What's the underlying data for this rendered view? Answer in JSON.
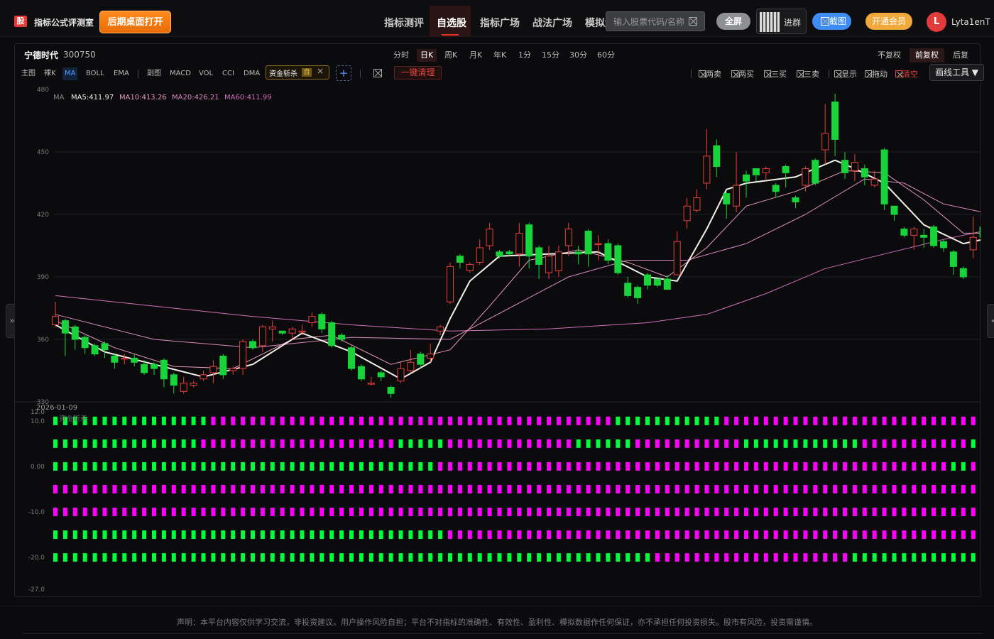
{
  "header": {
    "logo_char": "股",
    "brand": "指标公式评测室",
    "open_desktop": "后期桌面打开",
    "nav": [
      "指标测评",
      "自选股",
      "指标广场",
      "战法广场",
      "模拟盘"
    ],
    "active_nav": 1,
    "search_placeholder": "输入股票代码/名称",
    "fullscreen": "全屏",
    "join_group": "进群",
    "screenshot": "截图",
    "vip": "开通会员",
    "avatar_letter": "L",
    "username": "Lyta1enT"
  },
  "stock": {
    "name": "宁德时代",
    "code": "300750"
  },
  "periods": [
    "分时",
    "日K",
    "周K",
    "月K",
    "年K",
    "1分",
    "15分",
    "30分",
    "60分"
  ],
  "active_period": 1,
  "adjust": [
    "不复权",
    "前复权",
    "后复权"
  ],
  "active_adjust": 1,
  "indicator_row": {
    "main_label": "主图",
    "bare_k": "裸K",
    "main_inds": [
      "MA",
      "BOLL",
      "EMA"
    ],
    "active_main": 0,
    "sub_label": "副图",
    "sub_inds": [
      "MACD",
      "VOL",
      "CCI",
      "DMA"
    ],
    "custom_tag": "资金斩杀",
    "custom_badge": "自",
    "add": "+",
    "clear_all": "一键清理"
  },
  "tools": [
    "两卖",
    "两买",
    "三买",
    "三卖",
    "显示",
    "拖动",
    "清空"
  ],
  "draw_tools": "画线工具",
  "ma_legend": {
    "label": "MA",
    "ma5": "MA5:411.97",
    "ma10": "MA10:413.26",
    "ma20": "MA20:426.21",
    "ma60": "MA60:411.99"
  },
  "colors": {
    "up": "#e8413b",
    "down": "#18d43a",
    "ma5": "#f4efe6",
    "ma10": "#e99bb9",
    "ma20": "#d98ac0",
    "ma60": "#d06fb8",
    "sub_green": "#00ff3c",
    "sub_magenta": "#ff00ff"
  },
  "date_label": "2026-01-09",
  "sub_title": "资金斩杀",
  "chart_data": {
    "type": "candlestick",
    "y_ticks": [
      "480",
      "450",
      "420",
      "390",
      "360",
      "330"
    ],
    "ylim": [
      330,
      480
    ],
    "sub_ticks": [
      "12.0",
      "10.0",
      "0.00",
      "-10.0",
      "-20.0",
      "-27.0"
    ],
    "sub_ylim": [
      -27,
      12
    ],
    "candles": [
      [
        367,
        371,
        378,
        366
      ],
      [
        369,
        363,
        370,
        352
      ],
      [
        366,
        360,
        367,
        355
      ],
      [
        361,
        356,
        362,
        353
      ],
      [
        357,
        353,
        358,
        352
      ],
      [
        358,
        355,
        359,
        351
      ],
      [
        352,
        349,
        353,
        346
      ],
      [
        351,
        351,
        353,
        348
      ],
      [
        351,
        349,
        353,
        347
      ],
      [
        348,
        344,
        350,
        343
      ],
      [
        348,
        346,
        349,
        343
      ],
      [
        350,
        341,
        351,
        337
      ],
      [
        343,
        338,
        344,
        334
      ],
      [
        335,
        339,
        342,
        334
      ],
      [
        338,
        339,
        340,
        337
      ],
      [
        341,
        343,
        345,
        340
      ],
      [
        344,
        347,
        350,
        339
      ],
      [
        352,
        343,
        353,
        341
      ],
      [
        345,
        346,
        347,
        343
      ],
      [
        346,
        359,
        360,
        343
      ],
      [
        359,
        356,
        360,
        355
      ],
      [
        357,
        366,
        367,
        354
      ],
      [
        365,
        366,
        369,
        359
      ],
      [
        364,
        363,
        364,
        362
      ],
      [
        363,
        365,
        366,
        360
      ],
      [
        364,
        364,
        367,
        362
      ],
      [
        368,
        371,
        373,
        366
      ],
      [
        372,
        365,
        373,
        363
      ],
      [
        368,
        357,
        369,
        356
      ],
      [
        362,
        360,
        363,
        359
      ],
      [
        356,
        346,
        357,
        345
      ],
      [
        347,
        341,
        348,
        340
      ],
      [
        339,
        339,
        342,
        338
      ],
      [
        344,
        342,
        345,
        340
      ],
      [
        337,
        334,
        338,
        332
      ],
      [
        340,
        346,
        349,
        339
      ],
      [
        345,
        349,
        355,
        344
      ],
      [
        353,
        348,
        354,
        346
      ],
      [
        351,
        353,
        358,
        349
      ],
      [
        364,
        366,
        367,
        362
      ],
      [
        378,
        395,
        397,
        377
      ],
      [
        400,
        397,
        401,
        394
      ],
      [
        393,
        396,
        397,
        392
      ],
      [
        397,
        404,
        408,
        396
      ],
      [
        405,
        413,
        416,
        403
      ],
      [
        402,
        400,
        403,
        399
      ],
      [
        402,
        401,
        403,
        400
      ],
      [
        401,
        411,
        416,
        395
      ],
      [
        415,
        400,
        416,
        394
      ],
      [
        404,
        396,
        405,
        389
      ],
      [
        392,
        400,
        405,
        389
      ],
      [
        393,
        402,
        405,
        390
      ],
      [
        405,
        413,
        416,
        400
      ],
      [
        402,
        401,
        405,
        396
      ],
      [
        412,
        401,
        413,
        395
      ],
      [
        406,
        406,
        410,
        398
      ],
      [
        406,
        398,
        408,
        396
      ],
      [
        405,
        392,
        406,
        391
      ],
      [
        387,
        381,
        390,
        380
      ],
      [
        385,
        380,
        386,
        377
      ],
      [
        391,
        386,
        392,
        384
      ],
      [
        389,
        386,
        389,
        385
      ],
      [
        389,
        384,
        391,
        384
      ],
      [
        391,
        407,
        412,
        391
      ],
      [
        417,
        424,
        428,
        413
      ],
      [
        422,
        428,
        432,
        421
      ],
      [
        435,
        448,
        461,
        432
      ],
      [
        453,
        443,
        456,
        438
      ],
      [
        430,
        425,
        431,
        418
      ],
      [
        424,
        434,
        450,
        421
      ],
      [
        439,
        436,
        441,
        428
      ],
      [
        442,
        439,
        442,
        436
      ],
      [
        440,
        442,
        443,
        437
      ],
      [
        434,
        431,
        435,
        428
      ],
      [
        443,
        440,
        444,
        433
      ],
      [
        428,
        426,
        429,
        423
      ],
      [
        434,
        442,
        443,
        431
      ],
      [
        446,
        435,
        447,
        434
      ],
      [
        451,
        459,
        473,
        444
      ],
      [
        474,
        456,
        478,
        448
      ],
      [
        446,
        440,
        450,
        437
      ],
      [
        441,
        445,
        449,
        436
      ],
      [
        442,
        438,
        444,
        434
      ],
      [
        434,
        437,
        441,
        433
      ],
      [
        451,
        425,
        452,
        422
      ],
      [
        424,
        420,
        424,
        417
      ],
      [
        413,
        410,
        414,
        409
      ],
      [
        410,
        413,
        414,
        403
      ],
      [
        410,
        409,
        413,
        404
      ],
      [
        414,
        405,
        415,
        404
      ],
      [
        407,
        404,
        408,
        402
      ],
      [
        402,
        395,
        403,
        391
      ],
      [
        394,
        390,
        395,
        389
      ],
      [
        403,
        409,
        419,
        399
      ],
      [
        414,
        409,
        424,
        406
      ],
      [
        414,
        418,
        424,
        413
      ]
    ],
    "ma": {
      "ma5": [
        [
          0,
          367
        ],
        [
          5,
          354
        ],
        [
          10,
          348
        ],
        [
          15,
          342
        ],
        [
          20,
          348
        ],
        [
          25,
          363
        ],
        [
          30,
          354
        ],
        [
          35,
          341
        ],
        [
          38,
          349
        ],
        [
          40,
          370
        ],
        [
          42,
          388
        ],
        [
          45,
          400
        ],
        [
          50,
          401
        ],
        [
          55,
          402
        ],
        [
          60,
          390
        ],
        [
          63,
          388
        ],
        [
          66,
          413
        ],
        [
          68,
          432
        ],
        [
          70,
          435
        ],
        [
          75,
          438
        ],
        [
          79,
          446
        ],
        [
          81,
          442
        ],
        [
          84,
          435
        ],
        [
          88,
          415
        ],
        [
          92,
          406
        ],
        [
          95,
          409
        ]
      ],
      "ma10": [
        [
          0,
          369
        ],
        [
          6,
          356
        ],
        [
          12,
          347
        ],
        [
          18,
          346
        ],
        [
          24,
          360
        ],
        [
          28,
          362
        ],
        [
          34,
          348
        ],
        [
          40,
          355
        ],
        [
          44,
          376
        ],
        [
          48,
          398
        ],
        [
          53,
          403
        ],
        [
          58,
          397
        ],
        [
          62,
          390
        ],
        [
          66,
          404
        ],
        [
          70,
          424
        ],
        [
          75,
          431
        ],
        [
          80,
          441
        ],
        [
          84,
          440
        ],
        [
          88,
          427
        ],
        [
          92,
          411
        ],
        [
          95,
          411
        ]
      ],
      "ma20": [
        [
          0,
          372
        ],
        [
          10,
          360
        ],
        [
          20,
          356
        ],
        [
          30,
          361
        ],
        [
          40,
          360
        ],
        [
          46,
          375
        ],
        [
          52,
          390
        ],
        [
          58,
          398
        ],
        [
          64,
          398
        ],
        [
          70,
          406
        ],
        [
          76,
          420
        ],
        [
          82,
          437
        ],
        [
          86,
          435
        ],
        [
          90,
          425
        ],
        [
          95,
          420
        ]
      ],
      "ma60": [
        [
          0,
          381
        ],
        [
          10,
          376
        ],
        [
          20,
          371
        ],
        [
          30,
          367
        ],
        [
          40,
          364
        ],
        [
          50,
          365
        ],
        [
          60,
          368
        ],
        [
          66,
          372
        ],
        [
          72,
          382
        ],
        [
          78,
          394
        ],
        [
          84,
          401
        ],
        [
          90,
          408
        ],
        [
          95,
          413
        ]
      ]
    },
    "sub_rows": [
      {
        "level": 10,
        "pattern": "ggggggggggggggggmmmmmmmmmmmmmmmmmmmmmmmmmmmmmmmmmmmmmmmmmgggggggggggmmmmmmmmmmmmmmmmmmmmmmmmmmmmmmmm"
      },
      {
        "level": 5,
        "pattern": "gggggggggggggggmmmmmmmmmmmmmmmmmmmmgggggmmmmmmmmmmmmmggggggmmmmmmmmmmmggggggggggggmmmmmmmmmmmggggggg"
      },
      {
        "level": 0,
        "pattern": "gggggggggggggggggggggggggggggggggggggggmmmmmmmmmmmmmmmmmmmmmmmmmmmmmmmmmmmmmmmmmmmmmmmmmmmmggmmmm"
      },
      {
        "level": -5,
        "pattern": "mmmmmmmmmmmmmmmmmmmmmmmmmmmmmmmmmmmmmmmmmmmmmmmmmmmmmmmmmmmmmmmmmmmmmmmmmmmmmmmmmmmmmmmmmmmmmmmm"
      },
      {
        "level": -10,
        "pattern": "mmmmmmmmmmmmmmmmmmmmmmmmmmmmmmmmmmmmmmmmmmmmmmmmmmmmmmmmmmmmmmmmmmmmmmmmmmmmmmmmmmmmmmmmmmmmmmmm"
      },
      {
        "level": -15,
        "pattern": "ggggggggggggggggggggggggggggggggggggggggmmmmmmmmmmmmmmmmmmmmmmmmmmmmmmmmmmmmmmmmmmmmmmmmmmmmmmmmmmmm"
      },
      {
        "level": -20,
        "pattern": "gggggggggggggggggggggggggggggggggggggggggggggggggggggggggggggmmmmmmmmmmmmmmmmmmmmgggggggggggggggggggg"
      }
    ]
  },
  "footer": "声明：本平台内容仅供学习交流，非投资建议。用户操作风险自担；平台不对指标的准确性、有效性、盈利性、模拟数据作任何保证，亦不承担任何投资损失。股市有风险，投资需谨慎。"
}
